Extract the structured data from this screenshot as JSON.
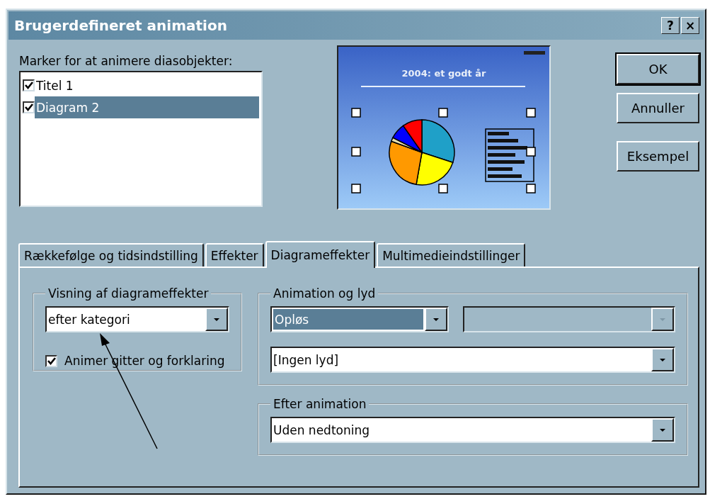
{
  "window": {
    "title": "Brugerdefineret animation",
    "title_buttons": [
      "?",
      "×"
    ]
  },
  "objects": {
    "label": "Marker for at animere diasobjekter:",
    "items": [
      {
        "label": "Titel 1",
        "checked": true,
        "selected": false
      },
      {
        "label": "Diagram 2",
        "checked": true,
        "selected": true
      }
    ]
  },
  "preview": {
    "slide_title": "2004: et godt år"
  },
  "buttons": [
    "OK",
    "Annuller",
    "Eksempel"
  ],
  "tabs": [
    {
      "label": "Rækkefølge og tidsindstilling",
      "selected": false
    },
    {
      "label": "Effekter",
      "selected": false
    },
    {
      "label": "Diagrameffekter",
      "selected": true
    },
    {
      "label": "Multimedieindstillinger",
      "selected": false
    }
  ],
  "chart_display": {
    "title": "Visning af diagrameffekter",
    "dropdown": {
      "value": "efter kategori"
    },
    "checkbox": {
      "label": "Animer gitter og forklaring",
      "checked": true
    }
  },
  "animation_sound": {
    "title": "Animation og lyd",
    "effect": {
      "value": "Opløs",
      "focused": true
    },
    "direction": {
      "disabled": true
    },
    "sound": {
      "value": "[Ingen lyd]"
    }
  },
  "after_animation": {
    "title": "Efter animation",
    "dropdown": {
      "value": "Uden nedtoning"
    }
  }
}
